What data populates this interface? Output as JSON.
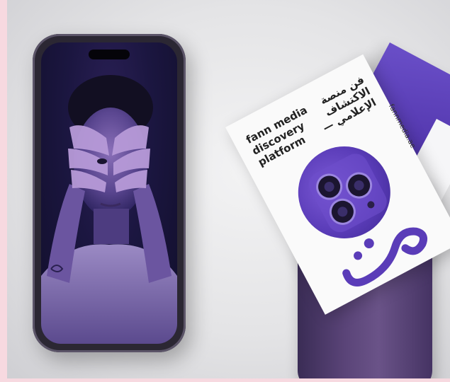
{
  "card": {
    "english_text": "fann media\ndiscovery\nplatform",
    "arabic_text": "فن منصة\nالاكتشاف\nالإعلامي —",
    "url": "fannmedia.ae"
  },
  "logo": {
    "name": "fann-logo"
  },
  "colors": {
    "brand_purple": "#5a3cb8",
    "background": "#e4e4e6",
    "border": "#f7d9e0"
  }
}
